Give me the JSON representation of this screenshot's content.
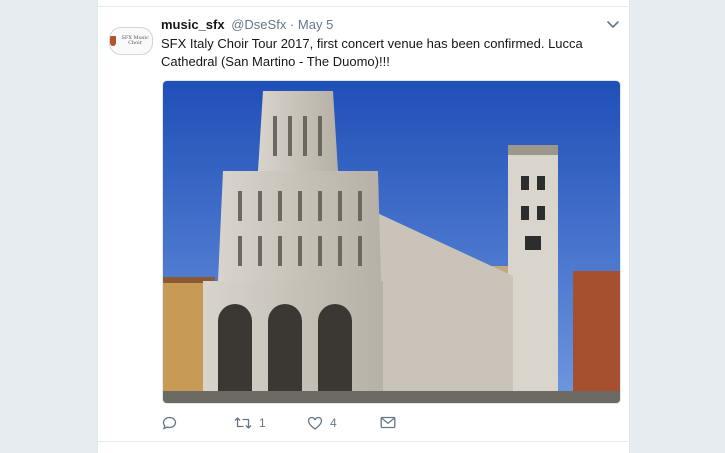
{
  "tweet": {
    "display_name": "music_sfx",
    "handle": "@DseSfx",
    "separator": "·",
    "date": "May 5",
    "text": "SFX Italy Choir Tour 2017, first concert venue has been confirmed. Lucca Cathedral (San Martino - The Duomo)!!!",
    "avatar_text": "SFX Music Choir",
    "menu_icon": "chevron-down-icon",
    "media_description_icon": "photo"
  },
  "actions": {
    "reply_icon": "reply-icon",
    "retweet_icon": "retweet-icon",
    "retweet_count": "1",
    "like_icon": "heart-icon",
    "like_count": "4",
    "dm_icon": "envelope-icon"
  },
  "colors": {
    "background": "#e6ecf0",
    "card": "#ffffff",
    "text": "#14171a",
    "secondary": "#657786",
    "sky": "#2a5fc8"
  }
}
